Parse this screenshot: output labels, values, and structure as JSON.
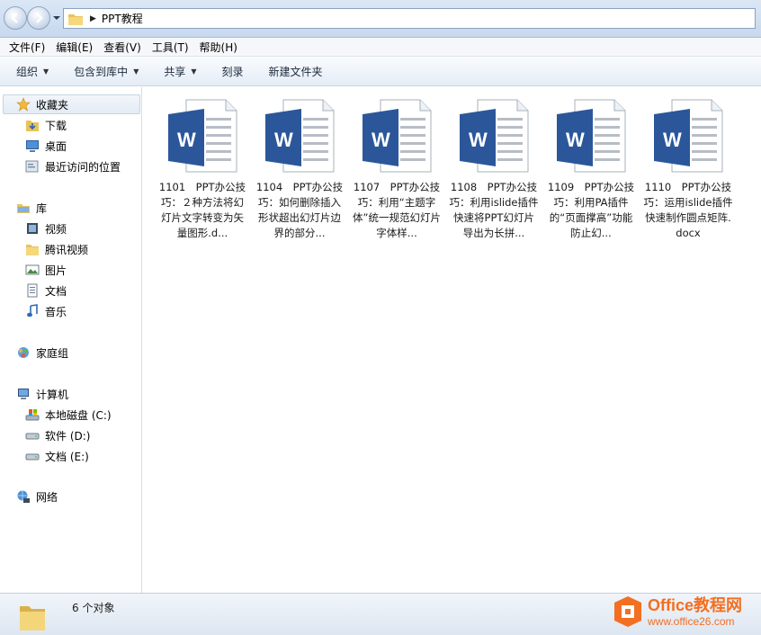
{
  "address": {
    "crumb": "PPT教程"
  },
  "menu": [
    "文件(F)",
    "编辑(E)",
    "查看(V)",
    "工具(T)",
    "帮助(H)"
  ],
  "toolbar": [
    {
      "label": "组织",
      "dropdown": true
    },
    {
      "label": "包含到库中",
      "dropdown": true
    },
    {
      "label": "共享",
      "dropdown": true
    },
    {
      "label": "刻录",
      "dropdown": false
    },
    {
      "label": "新建文件夹",
      "dropdown": false
    }
  ],
  "nav": {
    "favorites": {
      "label": "收藏夹",
      "items": [
        "下载",
        "桌面",
        "最近访问的位置"
      ]
    },
    "libraries": {
      "label": "库",
      "items": [
        "视频",
        "腾讯视频",
        "图片",
        "文档",
        "音乐"
      ]
    },
    "homegroup": {
      "label": "家庭组"
    },
    "computer": {
      "label": "计算机",
      "items": [
        "本地磁盘 (C:)",
        "软件 (D:)",
        "文档 (E:)"
      ]
    },
    "network": {
      "label": "网络"
    }
  },
  "files": [
    {
      "label": "1101　PPT办公技巧：２种方法将幻灯片文字转变为矢量图形.d..."
    },
    {
      "label": "1104　PPT办公技巧：如何删除插入形状超出幻灯片边界的部分..."
    },
    {
      "label": "1107　PPT办公技巧：利用“主题字体”统一规范幻灯片字体样..."
    },
    {
      "label": "1108　PPT办公技巧：利用islide插件快速将PPT幻灯片导出为长拼..."
    },
    {
      "label": "1109　PPT办公技巧：利用PA插件的“页面撑高”功能防止幻..."
    },
    {
      "label": "1110　PPT办公技巧：运用islide插件快速制作圆点矩阵.docx"
    }
  ],
  "status": {
    "count": "6 个对象"
  },
  "watermark": {
    "title": "Office教程网",
    "url": "www.office26.com"
  },
  "colors": {
    "word_blue": "#2b579a",
    "accent_orange": "#f36f21"
  }
}
